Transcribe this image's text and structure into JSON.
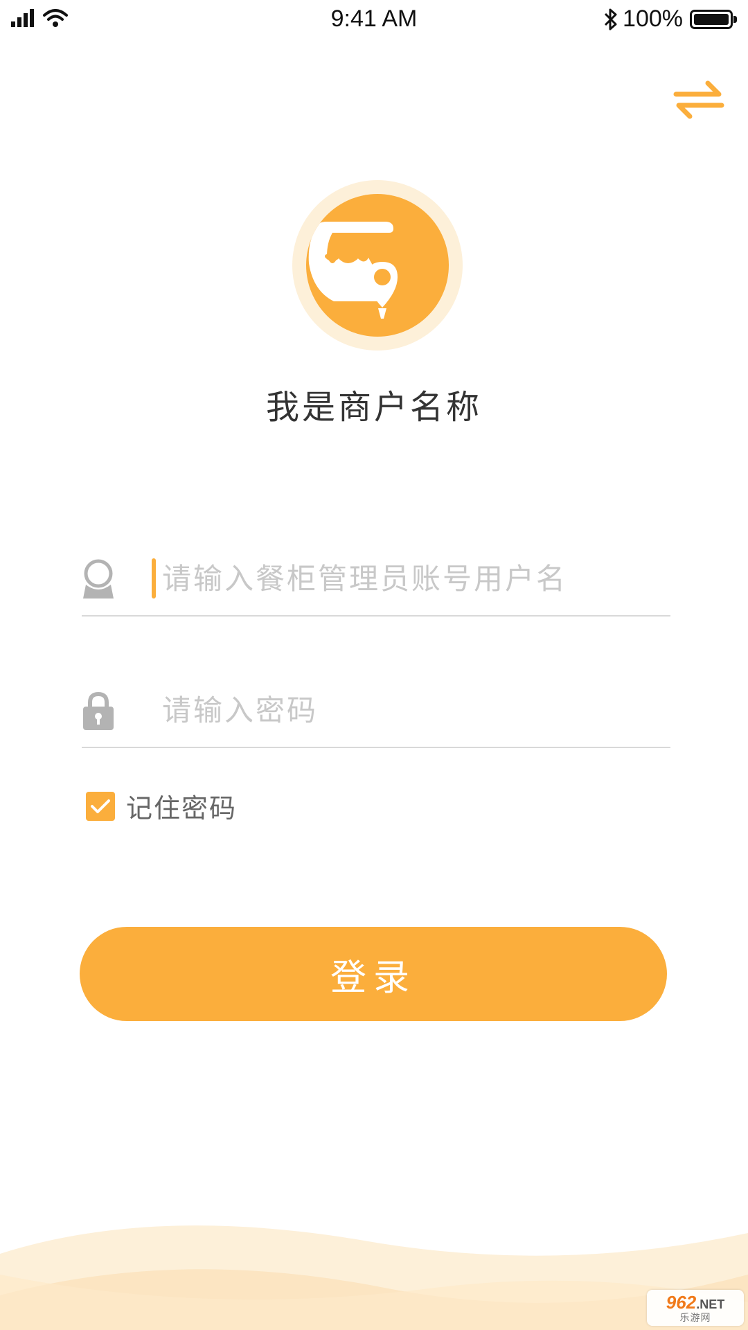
{
  "status_bar": {
    "time": "9:41 AM",
    "battery_percent": "100%",
    "battery_level": 1.0
  },
  "header": {
    "switch_icon": "swap-arrows-icon"
  },
  "brand": {
    "logo_icon": "shop-location-logo",
    "merchant_name": "我是商户名称"
  },
  "form": {
    "username": {
      "icon": "user-icon",
      "value": "",
      "placeholder": "请输入餐柜管理员账号用户名"
    },
    "password": {
      "icon": "lock-icon",
      "value": "",
      "placeholder": "请输入密码"
    },
    "remember": {
      "label": "记住密码",
      "checked": true
    },
    "login_label": "登录"
  },
  "watermark": {
    "top_number": "962",
    "top_suffix": ".NET",
    "bottom": "乐游网"
  },
  "colors": {
    "accent": "#fbae3c",
    "logo_ring": "#fdf0d9",
    "placeholder": "#c8c8c8",
    "icon_gray": "#b3b3b3"
  }
}
